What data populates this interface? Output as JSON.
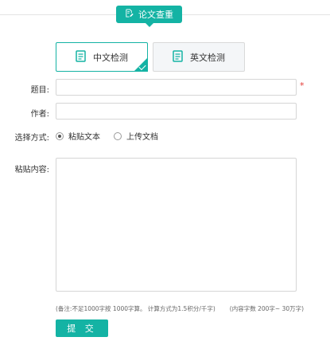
{
  "header": {
    "title": "论文查重",
    "icon": "edit-document-icon"
  },
  "modes": [
    {
      "label": "中文检测",
      "icon": "document-icon",
      "selected": true
    },
    {
      "label": "英文检测",
      "icon": "document-icon",
      "selected": false
    }
  ],
  "form": {
    "title_label": "题目:",
    "title_value": "",
    "title_required_mark": "*",
    "author_label": "作者:",
    "author_value": "",
    "method_label": "选择方式:",
    "methods": [
      {
        "label": "粘贴文本",
        "checked": true
      },
      {
        "label": "上传文档",
        "checked": false
      }
    ],
    "content_label": "粘贴内容:",
    "content_value": ""
  },
  "note": {
    "remark": "(备注:不足1000字按 1000字算。 计算方式为1.5积分/千字)",
    "limit": "(内容字数 200字~ 30万字)"
  },
  "submit_label": "提 交",
  "colors": {
    "accent": "#14b3a4",
    "required": "#e53935",
    "border": "#d6d6d6"
  }
}
